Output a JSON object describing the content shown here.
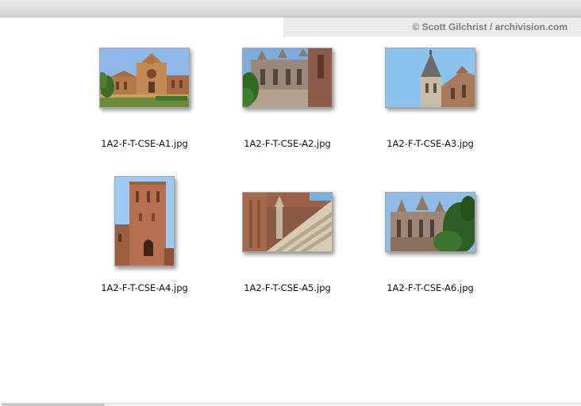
{
  "credit": "© Scott Gilchrist / archivision.com",
  "files": [
    {
      "name": "1A2-F-T-CSE-A1.jpg"
    },
    {
      "name": "1A2-F-T-CSE-A2.jpg"
    },
    {
      "name": "1A2-F-T-CSE-A3.jpg"
    },
    {
      "name": "1A2-F-T-CSE-A4.jpg"
    },
    {
      "name": "1A2-F-T-CSE-A5.jpg"
    },
    {
      "name": "1A2-F-T-CSE-A6.jpg"
    }
  ]
}
